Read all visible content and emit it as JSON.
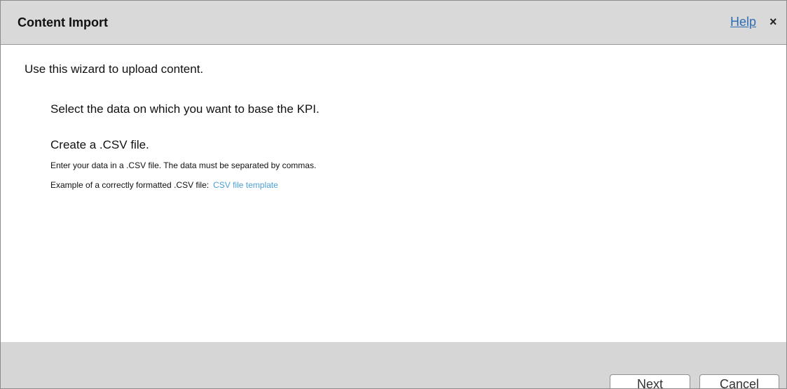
{
  "dialog": {
    "title": "Content Import",
    "help_label": "Help",
    "close_glyph": "×"
  },
  "content": {
    "intro": "Use this wizard to upload content.",
    "select_text": "Select the data on which you want to base the KPI.",
    "csv_heading": "Create a .CSV file.",
    "csv_description": "Enter your data in a .CSV file. The data must be separated by commas.",
    "example_label": "Example of a correctly formatted .CSV file:",
    "template_link": "CSV file template"
  },
  "footer": {
    "next_label": "Next",
    "cancel_label": "Cancel"
  },
  "colors": {
    "link": "#2e6db4",
    "template_link": "#4b9fd8",
    "titlebar_bg": "#d9d9d9",
    "footer_bg": "#d6d6d6"
  }
}
